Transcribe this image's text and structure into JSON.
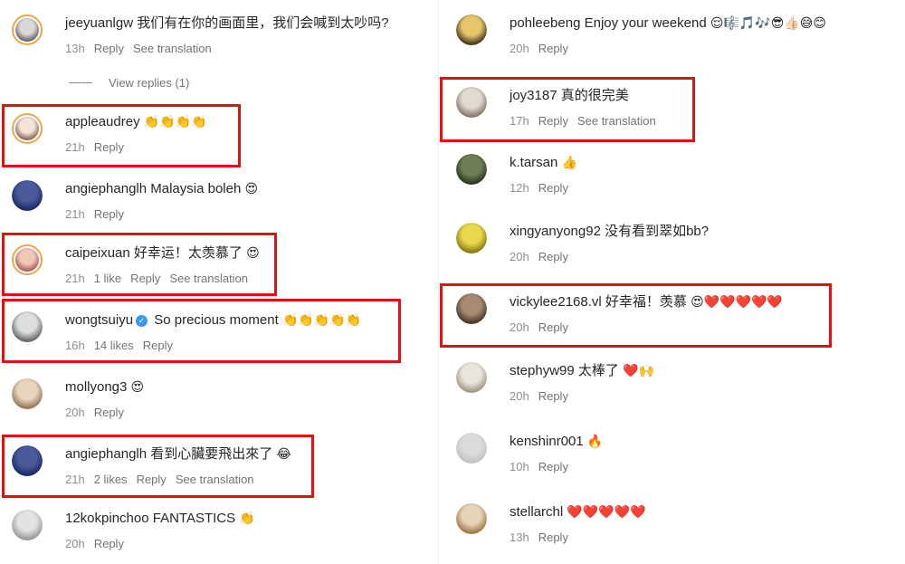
{
  "left": [
    {
      "user": "jeeyuanlgw",
      "text": "我们有在你的画面里，我们会喊到太吵吗?",
      "emoji": "",
      "time": "13h",
      "likes": "",
      "reply": "Reply",
      "translate": "See translation",
      "avatar_colors": [
        "#d9d9d9",
        "#6a6a6a"
      ],
      "story": true
    },
    {
      "user": "appleaudrey",
      "text": "",
      "emoji": "👏👏👏👏",
      "time": "21h",
      "likes": "",
      "reply": "Reply",
      "translate": "",
      "avatar_colors": [
        "#f4e3d9",
        "#8a6d5e"
      ],
      "story": true
    },
    {
      "user": "angiephanglh",
      "text": "Malaysia boleh",
      "emoji": "😍",
      "time": "21h",
      "likes": "",
      "reply": "Reply",
      "translate": "",
      "avatar_colors": [
        "#4b5a9b",
        "#1d2b66"
      ],
      "story": false
    },
    {
      "user": "caipeixuan",
      "text": "好幸运！太羡慕了",
      "emoji": "😍",
      "time": "21h",
      "likes": "1 like",
      "reply": "Reply",
      "translate": "See translation",
      "avatar_colors": [
        "#f0c7b7",
        "#b2605b"
      ],
      "story": true
    },
    {
      "user": "wongtsuiyu",
      "text": "So precious moment",
      "emoji": "👏👏👏👏👏",
      "time": "16h",
      "likes": "14 likes",
      "reply": "Reply",
      "translate": "",
      "avatar_colors": [
        "#dedede",
        "#6b6b6b"
      ],
      "story": false,
      "verified": true
    },
    {
      "user": "mollyong3",
      "text": "",
      "emoji": "😍",
      "time": "20h",
      "likes": "",
      "reply": "Reply",
      "translate": "",
      "avatar_colors": [
        "#e8d5bf",
        "#9c7a5c"
      ],
      "story": false
    },
    {
      "user": "angiephanglh",
      "text": "看到心臟要飛出來了",
      "emoji": "😂",
      "time": "21h",
      "likes": "2 likes",
      "reply": "Reply",
      "translate": "See translation",
      "avatar_colors": [
        "#4b5a9b",
        "#1d2b66"
      ],
      "story": false
    },
    {
      "user": "12kokpinchoo",
      "text": "FANTASTICS",
      "emoji": "👏",
      "time": "20h",
      "likes": "",
      "reply": "Reply",
      "translate": "",
      "avatar_colors": [
        "#e2e2e2",
        "#9b9b9b"
      ],
      "story": false
    }
  ],
  "view_replies": "View replies (1)",
  "right": [
    {
      "user": "pohleebeng",
      "text": "Enjoy your weekend",
      "emoji": "😌🎼🎵🎶😎👍🏻😅😊",
      "time": "20h",
      "likes": "",
      "reply": "Reply",
      "translate": "",
      "avatar_colors": [
        "#e6c66b",
        "#4a3c1d"
      ],
      "story": false
    },
    {
      "user": "joy3187",
      "text": "真的很完美",
      "emoji": "",
      "time": "17h",
      "likes": "",
      "reply": "Reply",
      "translate": "See translation",
      "avatar_colors": [
        "#e2d9cf",
        "#8b7b6c"
      ],
      "story": false
    },
    {
      "user": "k.tarsan",
      "text": "",
      "emoji": "👍",
      "time": "12h",
      "likes": "",
      "reply": "Reply",
      "translate": "",
      "avatar_colors": [
        "#6f7f55",
        "#2f3a24"
      ],
      "story": false
    },
    {
      "user": "xingyanyong92",
      "text": "没有看到翠如bb?",
      "emoji": "",
      "time": "20h",
      "likes": "",
      "reply": "Reply",
      "translate": "",
      "avatar_colors": [
        "#e9d84e",
        "#8e7d12"
      ],
      "story": false
    },
    {
      "user": "vickylee2168.vl",
      "text": "好幸福！羡慕",
      "emoji": "😍❤️❤️❤️❤️❤️",
      "time": "20h",
      "likes": "",
      "reply": "Reply",
      "translate": "",
      "avatar_colors": [
        "#a78b73",
        "#4d3a2a"
      ],
      "story": false
    },
    {
      "user": "stephyw99",
      "text": "太棒了",
      "emoji": "❤️🙌",
      "time": "20h",
      "likes": "",
      "reply": "Reply",
      "translate": "",
      "avatar_colors": [
        "#eae6dc",
        "#a49b87"
      ],
      "story": false
    },
    {
      "user": "kenshinr001",
      "text": "",
      "emoji": "🔥",
      "time": "10h",
      "likes": "",
      "reply": "Reply",
      "translate": "",
      "avatar_colors": [
        "#dbdbdb",
        "#c4c4c4"
      ],
      "story": false
    },
    {
      "user": "stellarchl",
      "text": "",
      "emoji": "❤️❤️❤️❤️❤️",
      "time": "13h",
      "likes": "",
      "reply": "Reply",
      "translate": "",
      "avatar_colors": [
        "#e6d4b9",
        "#a37a4c"
      ],
      "story": false
    }
  ],
  "highlight_color": "#e11111"
}
